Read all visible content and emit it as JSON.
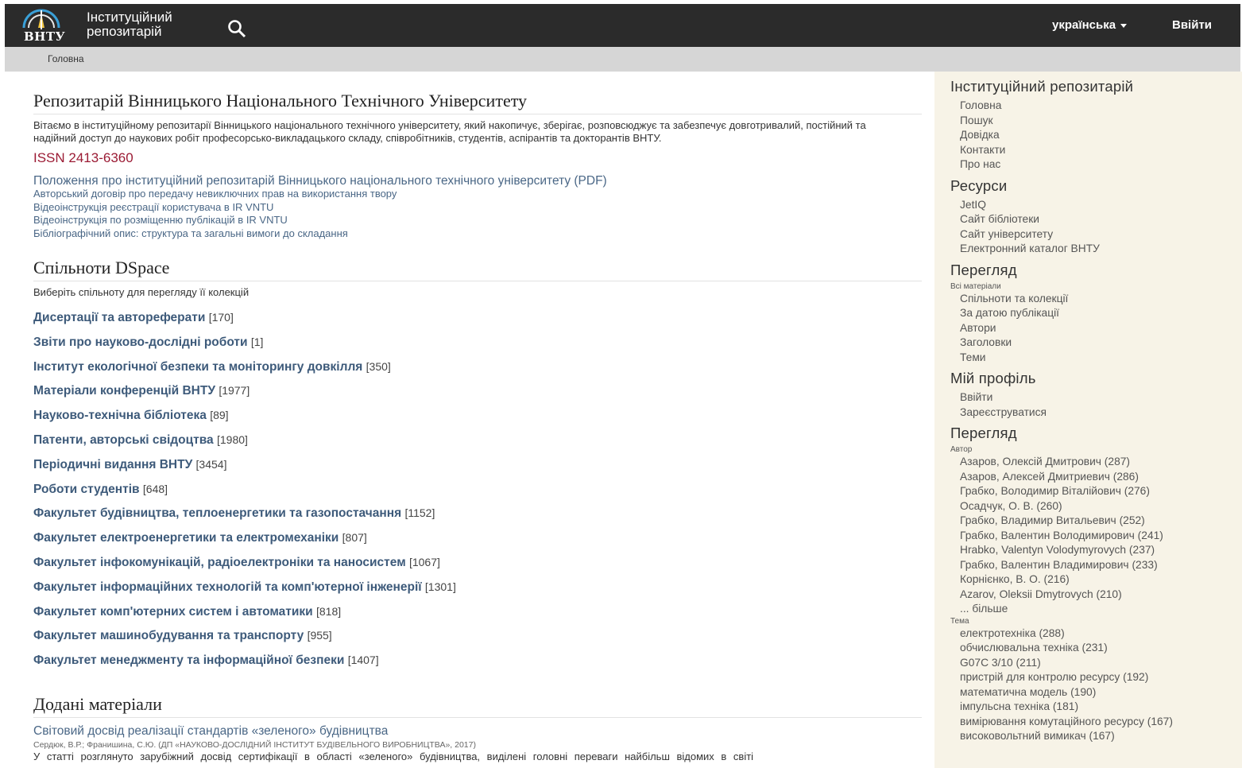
{
  "header": {
    "logo_text": "ВНТУ",
    "brand_line1": "Інституційний",
    "brand_line2": "репозитарій",
    "language": "українська",
    "login": "Ввійти"
  },
  "breadcrumb": {
    "home": "Головна"
  },
  "main": {
    "title": "Репозитарій Вінницького Національного Технічного Університету",
    "intro": "Вітаємо в інституційному репозитарії Вінницького національного технічного університету, який накопичує, зберігає, розповсюджує та забезпечує довготривалий, постійний та надійний доступ до наукових робіт професорсько-викладацького складу, співробітників, студентів, аспірантів та докторантів ВНТУ.",
    "issn": "ISSN 2413-6360",
    "doc_links": [
      "Положення про інституційний репозитарій Вінницького національного технічного університету (PDF)",
      "Авторський договір про передачу невиключних прав на використання твору",
      "Відеоінструкція реєстрації користувача в IR VNTU",
      "Відеоінструкція по розміщенню публікацій в IR VNTU",
      "Бібліографічний опис: структура та загальні вимоги до складання"
    ],
    "communities_title": "Спільноти DSpace",
    "communities_hint": "Виберіть спільноту для перегляду її колекцій",
    "communities": [
      {
        "name": "Дисертації та автореферати",
        "count": "[170]"
      },
      {
        "name": "Звіти про науково-дослідні роботи",
        "count": "[1]"
      },
      {
        "name": "Інститут екологічної безпеки та моніторингу довкілля",
        "count": "[350]"
      },
      {
        "name": "Матеріали конференцій ВНТУ",
        "count": "[1977]"
      },
      {
        "name": "Науково-технічна бібліотека",
        "count": "[89]"
      },
      {
        "name": "Патенти, авторські свідоцтва",
        "count": "[1980]"
      },
      {
        "name": "Періодичні видання ВНТУ",
        "count": "[3454]"
      },
      {
        "name": "Роботи студентів",
        "count": "[648]"
      },
      {
        "name": "Факультет будівництва, теплоенергетики та газопостачання",
        "count": "[1152]"
      },
      {
        "name": "Факультет електроенергетики та електромеханіки",
        "count": "[807]"
      },
      {
        "name": "Факультет інфокомунікацій, радіоелектроніки та наносистем",
        "count": "[1067]"
      },
      {
        "name": "Факультет інформаційних технологій та комп'ютерної інженерії",
        "count": "[1301]"
      },
      {
        "name": "Факультет комп'ютерних систем і автоматики",
        "count": "[818]"
      },
      {
        "name": "Факультет машинобудування та транспорту",
        "count": "[955]"
      },
      {
        "name": "Факультет менеджменту та інформаційної безпеки",
        "count": "[1407]"
      }
    ],
    "recent_title": "Додані матеріали",
    "recent_item": {
      "title": "Світовий досвід реалізації стандартів «зеленого» будівництва",
      "meta": "Сердюк, В.Р.; Франишина, С.Ю. (ДП «НАУКОВО-ДОСЛІДНИЙ ІНСТИТУТ БУДІВЕЛЬНОГО ВИРОБНИЦТВА», 2017)",
      "abstract": "У статті розглянуто зарубіжний досвід сертифікації в області «зеленого» будівництва, виділені головні переваги найбільш відомих в світі"
    }
  },
  "sidebar": {
    "repo_title": "Інституційний репозитарій",
    "repo_links": [
      "Головна",
      "Пошук",
      "Довідка",
      "Контакти",
      "Про нас"
    ],
    "resources_title": "Ресурси",
    "resources_links": [
      "JetIQ",
      "Сайт бібліотеки",
      "Сайт університету",
      "Електронний каталог ВНТУ"
    ],
    "browse_title": "Перегляд",
    "browse_sub": "Всі матеріали",
    "browse_links": [
      "Спільноти та колекції",
      "За датою публікації",
      "Автори",
      "Заголовки",
      "Теми"
    ],
    "profile_title": "Мій профіль",
    "profile_links": [
      "Ввійти",
      "Зареєструватися"
    ],
    "browse2_title": "Перегляд",
    "authors_sub": "Автор",
    "authors": [
      "Азаров, Олексій Дмитрович (287)",
      "Азаров, Алексей Дмитриевич (286)",
      "Грабко, Володимир Віталійович (276)",
      "Осадчук, О. В. (260)",
      "Грабко, Владимир Витальевич (252)",
      "Грабко, Валентин Володимирович (241)",
      "Hrabko, Valentyn Volodymyrovych (237)",
      "Грабко, Валентин Владимирович (233)",
      "Корнієнко, В. О. (216)",
      "Azarov, Oleksii Dmytrovych (210)",
      "... більше"
    ],
    "subjects_sub": "Тема",
    "subjects": [
      "електротехніка (288)",
      "обчислювальна техніка (231)",
      "G07C 3/10 (211)",
      "пристрій для контролю ресурсу (192)",
      "математична модель (190)",
      "імпульсна техніка (181)",
      "вимірювання комутаційного ресурсу (167)",
      "високовольтний вимикач (167)"
    ]
  },
  "icons": {
    "search": "search-icon",
    "logo": "vntu-logo-icon",
    "caret": "caret-down-icon"
  },
  "colors": {
    "header_bg": "#2b2b2b",
    "link": "#4a6786",
    "community": "#3d5a7a",
    "issn": "#9b1b34",
    "sidebar_bg": "#f7f3e7"
  }
}
